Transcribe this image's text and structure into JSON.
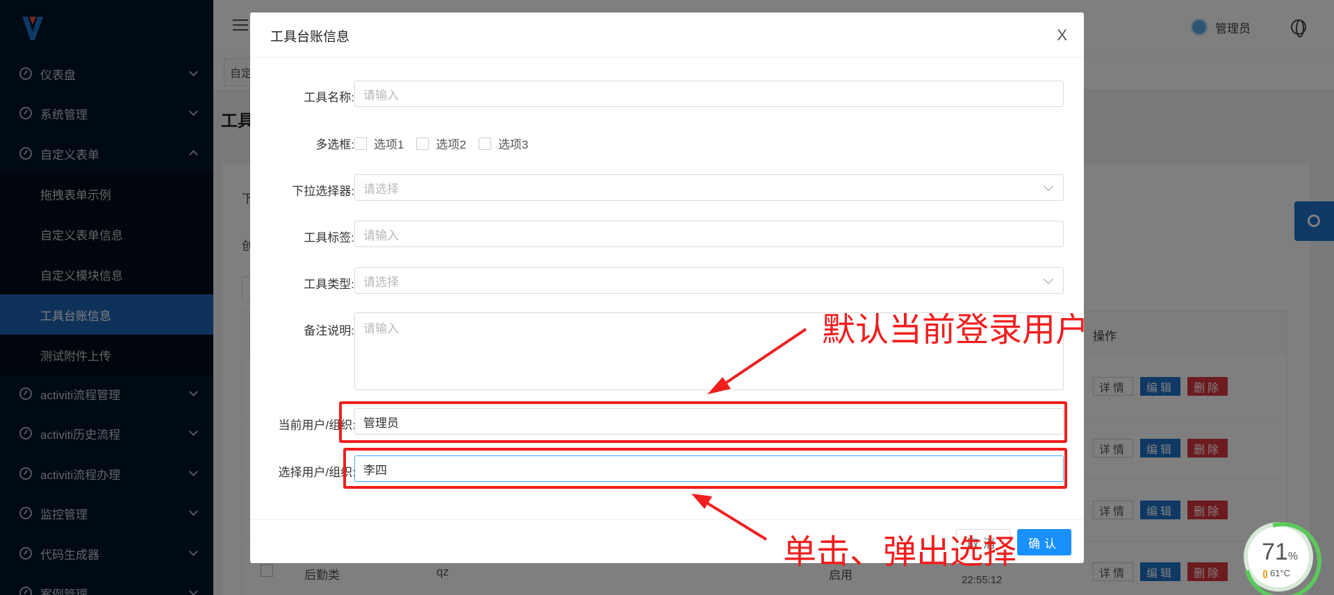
{
  "sidebar": {
    "items": [
      {
        "label": "仪表盘"
      },
      {
        "label": "系统管理"
      },
      {
        "label": "自定义表单"
      },
      {
        "label": "activiti流程管理"
      },
      {
        "label": "activiti历史流程"
      },
      {
        "label": "activiti流程办理"
      },
      {
        "label": "监控管理"
      },
      {
        "label": "代码生成器"
      },
      {
        "label": "案例管理"
      }
    ],
    "submenu": [
      {
        "label": "拖拽表单示例"
      },
      {
        "label": "自定义表单信息"
      },
      {
        "label": "自定义模块信息"
      },
      {
        "label": "工具台账信息"
      },
      {
        "label": "测试附件上传"
      }
    ]
  },
  "header": {
    "user_name": "管理员"
  },
  "background": {
    "tab_fragment": "自定",
    "title_fragment": "工具",
    "frag_1": "下",
    "frag_2": "创",
    "op_header": "操作",
    "row_buttons": {
      "detail": "详情",
      "edit": "编辑",
      "delete": "删除"
    },
    "last_row": {
      "col1": "后勤类",
      "col2": "qz",
      "status": "启用",
      "time": "22:55:12"
    }
  },
  "dialog": {
    "title": "工具台账信息",
    "close": "X",
    "fields": {
      "tool_name": {
        "label": "工具名称:",
        "placeholder": "请输入"
      },
      "checkbox": {
        "label": "多选框:",
        "options": [
          "选项1",
          "选项2",
          "选项3"
        ]
      },
      "dropdown": {
        "label": "下拉选择器:",
        "placeholder": "请选择"
      },
      "tool_tag": {
        "label": "工具标签:",
        "placeholder": "请输入"
      },
      "tool_type": {
        "label": "工具类型:",
        "placeholder": "请选择"
      },
      "remark": {
        "label": "备注说明:",
        "placeholder": "请输入"
      },
      "current_user": {
        "label": "当前用户/组织:",
        "value": "管理员"
      },
      "select_user": {
        "label": "选择用户/组织:",
        "value": "李四"
      }
    },
    "cancel": "取消",
    "confirm": "确认"
  },
  "annotations": {
    "top_text": "默认当前登录用户",
    "bottom_text": "单击、弹出选择",
    "color": "#f01e1e"
  },
  "gauge": {
    "percent": "71",
    "unit": "%",
    "temp": "61°C"
  }
}
